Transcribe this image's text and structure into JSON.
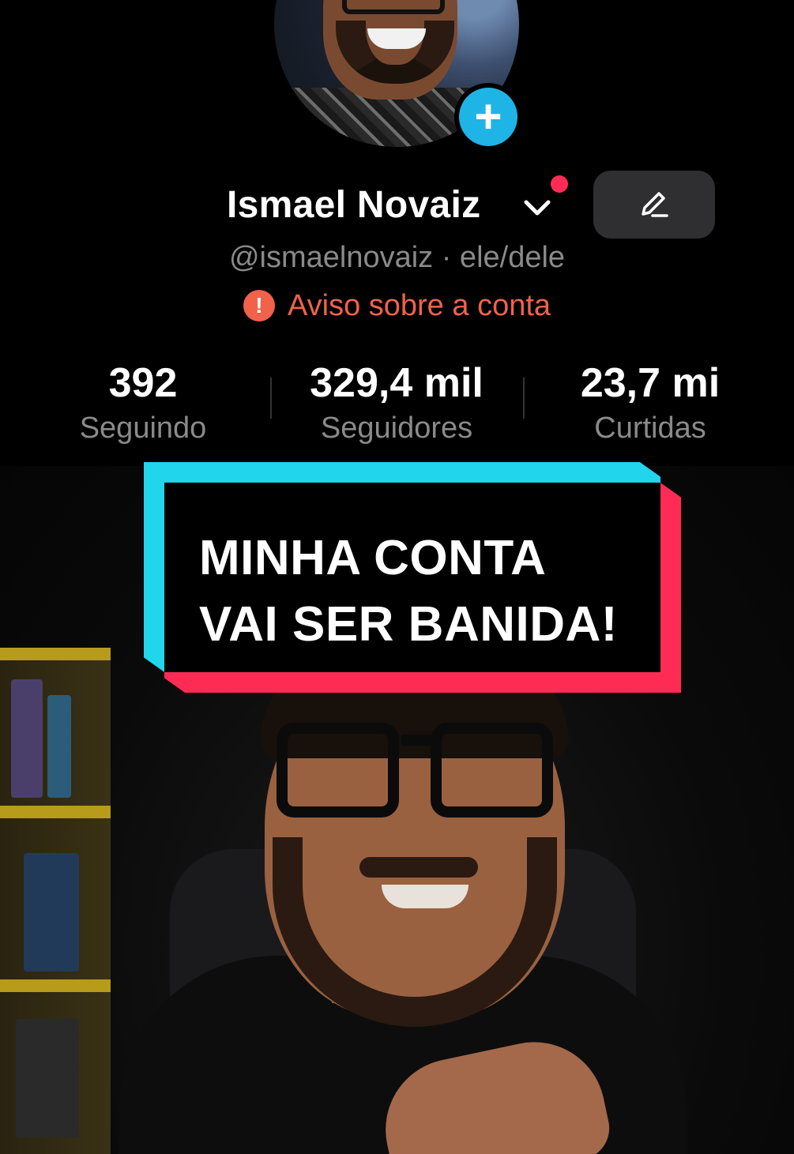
{
  "profile": {
    "name": "Ismael Novaiz",
    "handle": "@ismaelnovaiz · ele/dele",
    "warning": "Aviso sobre a conta",
    "warning_icon": "!",
    "add_icon": "+",
    "accent_colors": {
      "add": "#1fb4e6",
      "warning": "#f0624a",
      "notification": "#fe2c55"
    }
  },
  "stats": [
    {
      "value": "392",
      "label": "Seguindo"
    },
    {
      "value": "329,4 mil",
      "label": "Seguidores"
    },
    {
      "value": "23,7 mi",
      "label": "Curtidas"
    }
  ],
  "caption": {
    "line1": "MINHA CONTA",
    "line2": "VAI SER BANIDA!",
    "colors": {
      "outline_top": "#20d5ec",
      "outline_bottom": "#fe2c55",
      "fill": "#000000"
    }
  },
  "icons": {
    "avatar": "profile-photo",
    "add": "plus-icon",
    "chevron": "chevron-down-icon",
    "edit": "pencil-icon",
    "warning": "alert-icon"
  }
}
